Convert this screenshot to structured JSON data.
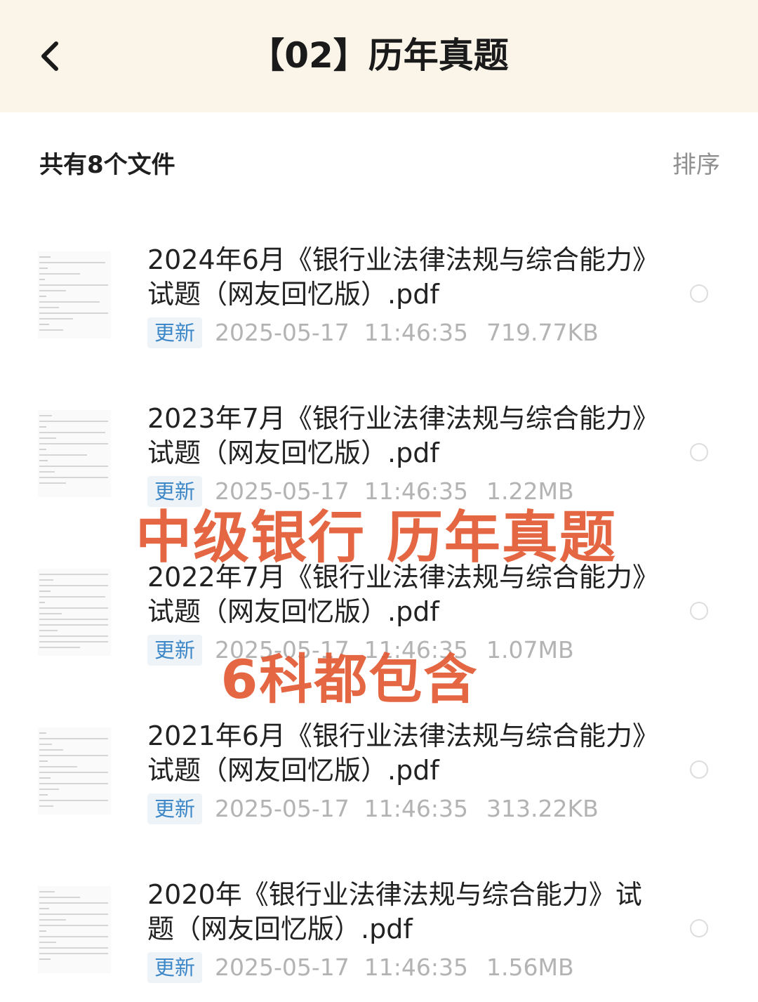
{
  "header": {
    "title": "【02】历年真题",
    "back_icon": "chevron-left-icon"
  },
  "summary": {
    "count_label": "共有8个文件",
    "sort_label": "排序"
  },
  "files": [
    {
      "name": "2024年6月《银行业法律法规与综合能力》试题（网友回忆版）.pdf",
      "tag": "更新",
      "datetime": "2025-05-17  11:46:35",
      "size": "719.77KB"
    },
    {
      "name": "2023年7月《银行业法律法规与综合能力》试题（网友回忆版）.pdf",
      "tag": "更新",
      "datetime": "2025-05-17  11:46:35",
      "size": "1.22MB"
    },
    {
      "name": "2022年7月《银行业法律法规与综合能力》试题（网友回忆版）.pdf",
      "tag": "更新",
      "datetime": "2025-05-17  11:46:35",
      "size": "1.07MB"
    },
    {
      "name": "2021年6月《银行业法律法规与综合能力》试题（网友回忆版）.pdf",
      "tag": "更新",
      "datetime": "2025-05-17  11:46:35",
      "size": "313.22KB"
    },
    {
      "name": "2020年《银行业法律法规与综合能力》试题（网友回忆版）.pdf",
      "tag": "更新",
      "datetime": "2025-05-17  11:46:35",
      "size": "1.56MB"
    }
  ],
  "overlay": {
    "line1": "中级银行 历年真题",
    "line2": "6科都包含",
    "color": "#e25a33"
  },
  "colors": {
    "header_bg": "#fbf5e9",
    "tag_text": "#3e88c8",
    "tag_bg": "#eef3f8"
  }
}
